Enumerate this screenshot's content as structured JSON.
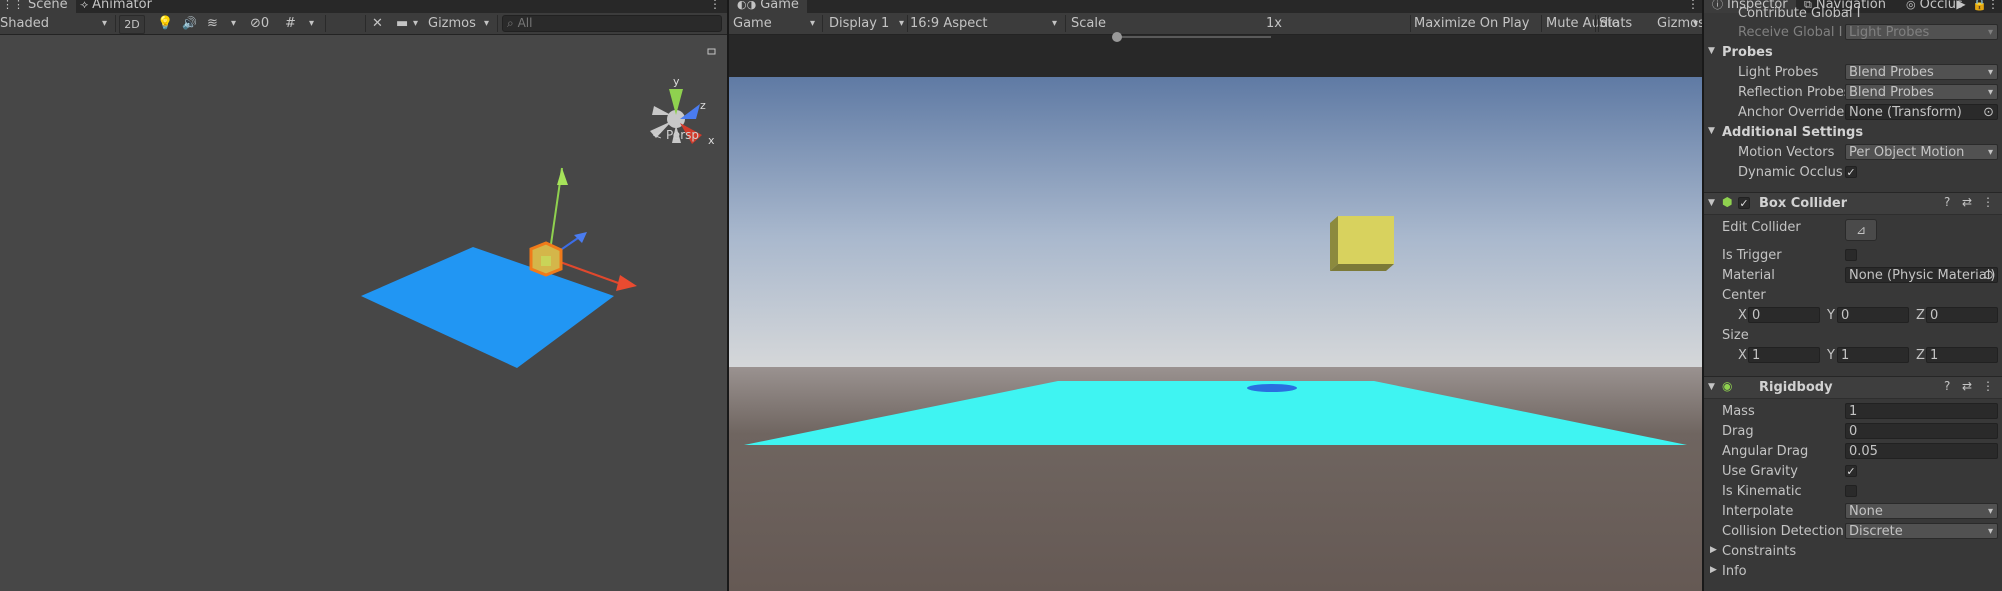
{
  "scene": {
    "tabs": [
      {
        "label": "Scene",
        "icon": "grid-icon"
      },
      {
        "label": "Animator",
        "icon": "animator-icon"
      }
    ],
    "toolbar": {
      "draw_mode": "Shaded",
      "mode_2d": "2D",
      "hidden_count": "0",
      "gizmos": "Gizmos",
      "search_placeholder": "All"
    },
    "gizmo": {
      "y": "y",
      "z": "z",
      "x": "x"
    },
    "persp_label": "Persp"
  },
  "game": {
    "tab": "Game",
    "toolbar": {
      "view": "Game",
      "display": "Display 1",
      "aspect": "16:9 Aspect",
      "scale_label": "Scale",
      "scale_value": "1x",
      "maximize": "Maximize On Play",
      "mute": "Mute Audio",
      "stats": "Stats",
      "gizmos": "Gizmos"
    }
  },
  "inspector": {
    "tabs": [
      {
        "label": "Inspector"
      },
      {
        "label": "Navigation"
      },
      {
        "label": "Occlus"
      }
    ],
    "cut_top_label": "Contribute Global I",
    "receive_gi": {
      "label": "Receive Global Illu",
      "value": "Light Probes"
    },
    "probes": {
      "title": "Probes",
      "light_probes": {
        "label": "Light Probes",
        "value": "Blend Probes"
      },
      "reflection_probes": {
        "label": "Reflection Probes",
        "value": "Blend Probes"
      },
      "anchor_override": {
        "label": "Anchor Override",
        "value": "None (Transform)"
      }
    },
    "additional": {
      "title": "Additional Settings",
      "motion_vectors": {
        "label": "Motion Vectors",
        "value": "Per Object Motion"
      },
      "dynamic_occlusion": {
        "label": "Dynamic Occlusio",
        "checked": true
      }
    },
    "box_collider": {
      "title": "Box Collider",
      "edit_collider": "Edit Collider",
      "is_trigger": "Is Trigger",
      "material": {
        "label": "Material",
        "value": "None (Physic Material)"
      },
      "center": {
        "label": "Center",
        "x": "0",
        "y": "0",
        "z": "0"
      },
      "size": {
        "label": "Size",
        "x": "1",
        "y": "1",
        "z": "1"
      },
      "axis": {
        "x": "X",
        "y": "Y",
        "z": "Z"
      }
    },
    "rigidbody": {
      "title": "Rigidbody",
      "mass": {
        "label": "Mass",
        "value": "1"
      },
      "drag": {
        "label": "Drag",
        "value": "0"
      },
      "angular_drag": {
        "label": "Angular Drag",
        "value": "0.05"
      },
      "use_gravity": {
        "label": "Use Gravity",
        "checked": true
      },
      "is_kinematic": {
        "label": "Is Kinematic",
        "checked": false
      },
      "interpolate": {
        "label": "Interpolate",
        "value": "None"
      },
      "collision_detection": {
        "label": "Collision Detection",
        "value": "Discrete"
      },
      "constraints": "Constraints",
      "info": "Info"
    }
  },
  "colors": {
    "scene_bg": "#474747",
    "scene_plane": "#2196f3",
    "game_plane": "#3ff4f2",
    "cube": "#d8d25e",
    "sky_top": "#5f7aa4",
    "ground": "#6b605b"
  }
}
